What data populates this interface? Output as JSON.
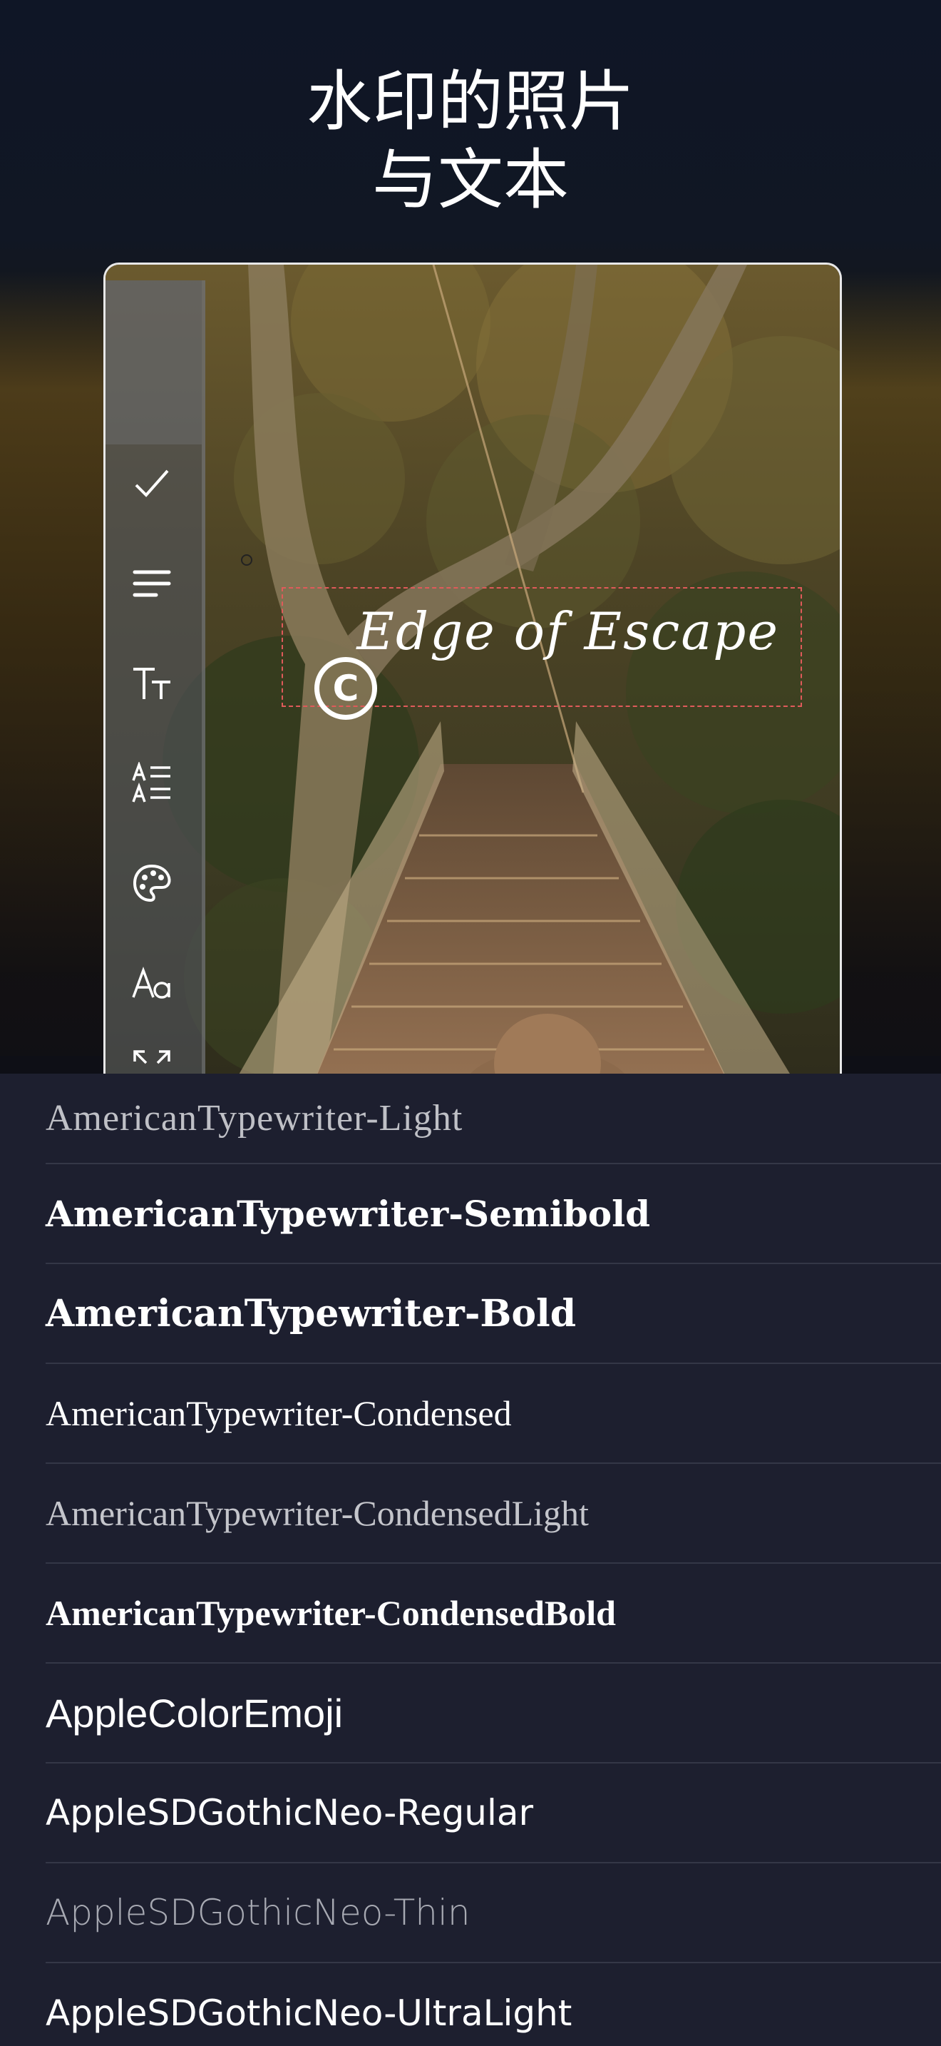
{
  "headline": {
    "line1": "水印的照片",
    "line2": "与文本"
  },
  "editor": {
    "watermark_text": "Edge of Escape",
    "copyright_symbol": "C",
    "toolbar_icons": [
      "check-icon",
      "align-left-icon",
      "text-size-icon",
      "text-spacing-icon",
      "palette-icon",
      "font-icon",
      "expand-icon"
    ]
  },
  "font_list": [
    {
      "name": "AmericanTypewriter-Light"
    },
    {
      "name": "AmericanTypewriter-Semibold"
    },
    {
      "name": "AmericanTypewriter-Bold"
    },
    {
      "name": "AmericanTypewriter-Condensed"
    },
    {
      "name": "AmericanTypewriter-CondensedLight"
    },
    {
      "name": "AmericanTypewriter-CondensedBold"
    },
    {
      "name": "AppleColorEmoji"
    },
    {
      "name": "AppleSDGothicNeo-Regular"
    },
    {
      "name": "AppleSDGothicNeo-Thin"
    },
    {
      "name": "AppleSDGothicNeo-UltraLight"
    }
  ],
  "colors": {
    "background": "#0f1524",
    "list_background": "#1d1f2f",
    "selection_dash": "#e05a5a"
  }
}
